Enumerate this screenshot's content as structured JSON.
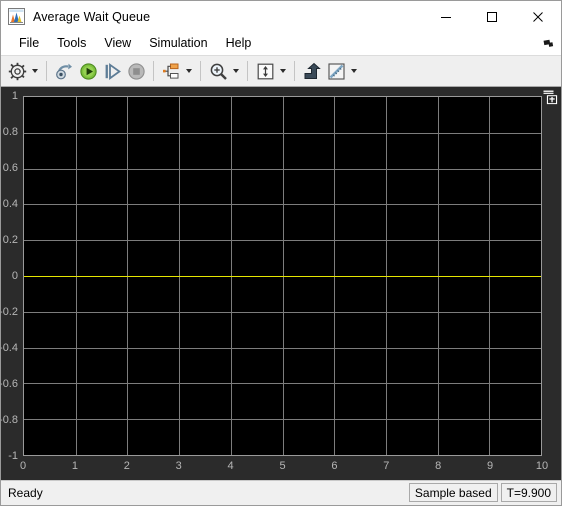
{
  "window": {
    "title": "Average Wait Queue",
    "icon": "scope-icon",
    "controls": [
      {
        "name": "minimize-button",
        "glyph": "minimize-icon"
      },
      {
        "name": "maximize-button",
        "glyph": "maximize-icon"
      },
      {
        "name": "close-button",
        "glyph": "close-icon"
      }
    ]
  },
  "menubar": {
    "items": [
      {
        "label": "File",
        "name": "menu-file"
      },
      {
        "label": "Tools",
        "name": "menu-tools"
      },
      {
        "label": "View",
        "name": "menu-view"
      },
      {
        "label": "Simulation",
        "name": "menu-simulation"
      },
      {
        "label": "Help",
        "name": "menu-help"
      }
    ],
    "overflow_icon": "menu-overflow-icon"
  },
  "toolbar": {
    "groups": [
      {
        "items": [
          {
            "icon": "configuration-properties-icon",
            "has_dropdown": true
          }
        ]
      },
      {
        "items": [
          {
            "icon": "run-back-to-start-icon",
            "has_dropdown": false
          },
          {
            "icon": "run-icon",
            "has_dropdown": false
          },
          {
            "icon": "step-forward-icon",
            "has_dropdown": false
          },
          {
            "icon": "stop-icon",
            "has_dropdown": false
          }
        ]
      },
      {
        "items": [
          {
            "icon": "signal-selector-icon",
            "has_dropdown": true
          }
        ]
      },
      {
        "items": [
          {
            "icon": "zoom-in-icon",
            "has_dropdown": true
          }
        ]
      },
      {
        "items": [
          {
            "icon": "autoscale-icon",
            "has_dropdown": true
          }
        ]
      },
      {
        "items": [
          {
            "icon": "cursor-measurements-icon",
            "has_dropdown": false
          },
          {
            "icon": "measurements-icon",
            "has_dropdown": true
          }
        ]
      }
    ]
  },
  "plot": {
    "corner_icon": "floating-scope-icon"
  },
  "chart_data": {
    "type": "line",
    "title": "",
    "xlabel": "",
    "ylabel": "",
    "xlim": [
      0,
      10
    ],
    "ylim": [
      -1,
      1
    ],
    "grid": true,
    "legend": "none",
    "background": "#000000",
    "grid_color": "#7d7d7d",
    "zero_line_color": "#e6e600",
    "xticks": [
      "0",
      "1",
      "2",
      "3",
      "4",
      "5",
      "6",
      "7",
      "8",
      "9",
      "10"
    ],
    "xtick_values": [
      0,
      1,
      2,
      3,
      4,
      5,
      6,
      7,
      8,
      9,
      10
    ],
    "yticks": [
      "1",
      "0.8",
      "0.6",
      "0.4",
      "0.2",
      "0",
      "-0.2",
      "-0.4",
      "-0.6",
      "-0.8",
      "-1"
    ],
    "ytick_values": [
      1,
      0.8,
      0.6,
      0.4,
      0.2,
      0,
      -0.2,
      -0.4,
      -0.6,
      -0.8,
      -1
    ],
    "series": [
      {
        "name": "Average Wait Queue",
        "color": "#e6e600",
        "x": [
          0,
          10
        ],
        "y": [
          0,
          0
        ]
      }
    ]
  },
  "statusbar": {
    "status": "Ready",
    "panels": [
      {
        "label": "Sample based",
        "name": "status-sample-mode"
      },
      {
        "label": "T=9.900",
        "name": "status-simulation-time"
      }
    ]
  }
}
